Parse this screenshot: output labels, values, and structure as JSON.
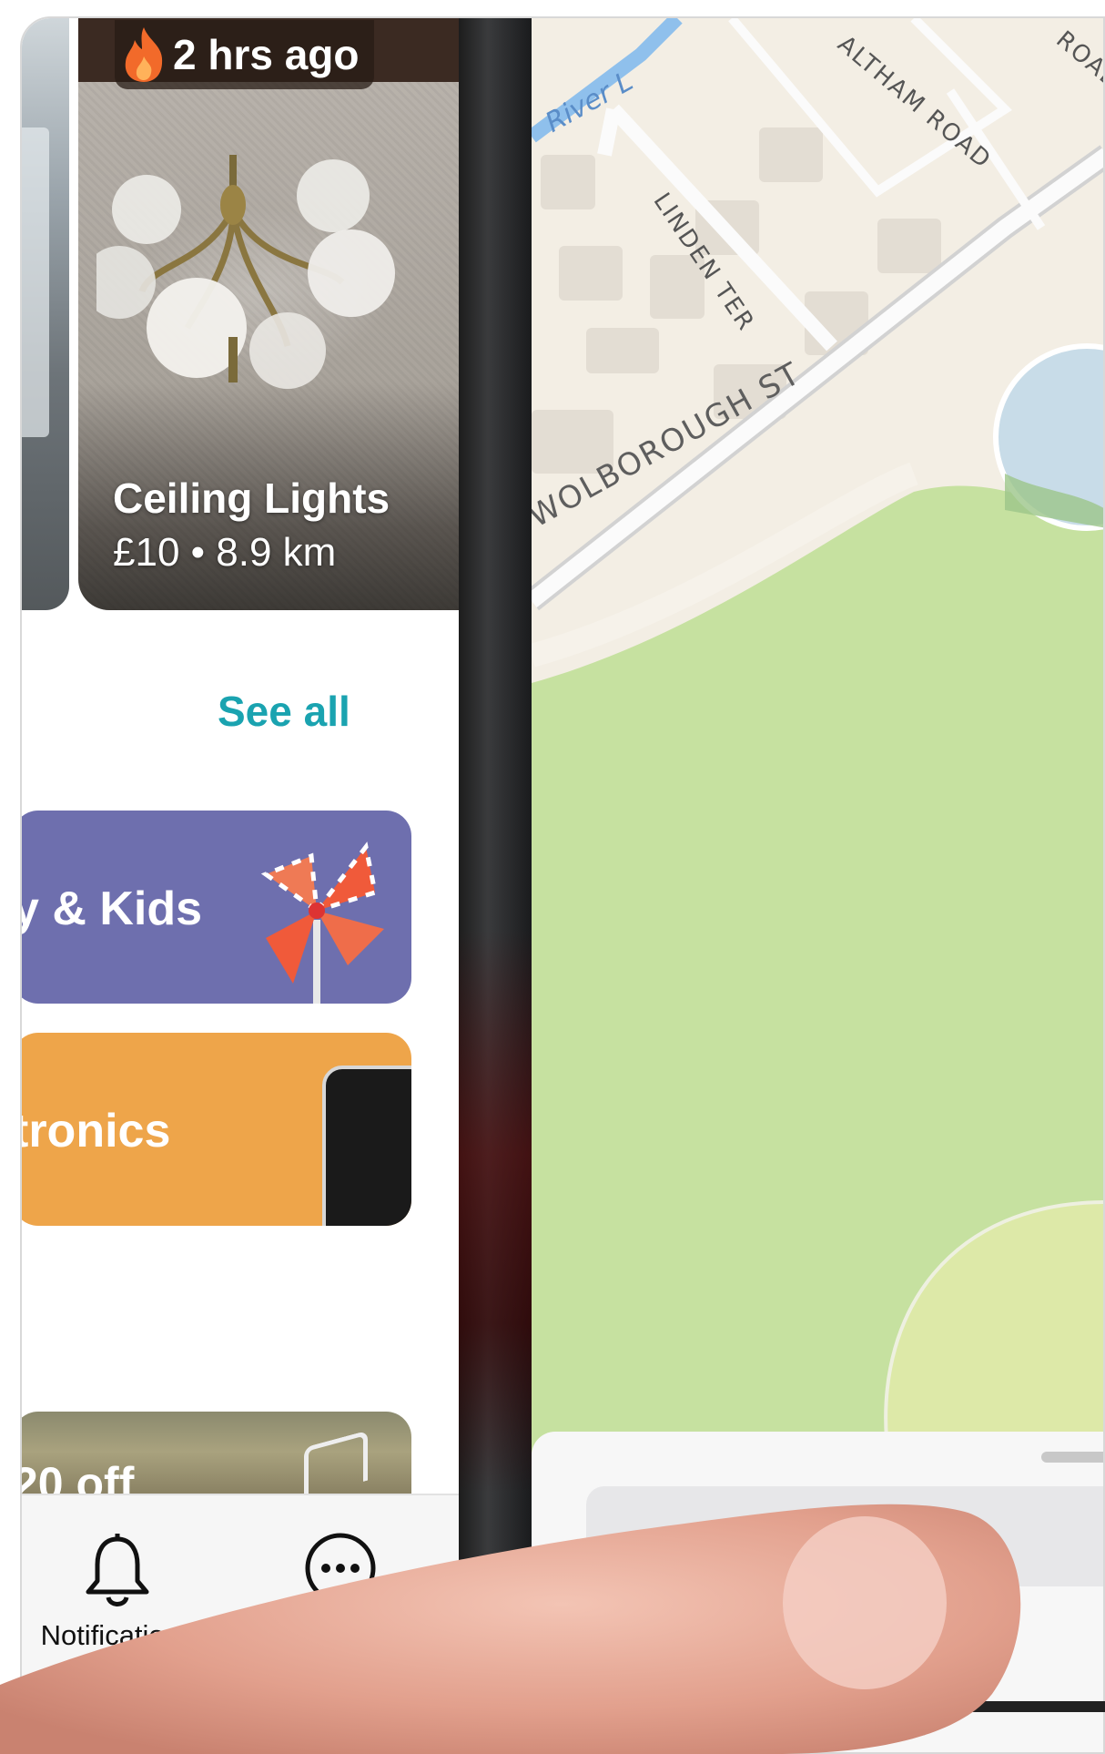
{
  "listing": {
    "posted": "2 hrs ago",
    "title": "Ceiling Lights",
    "meta": "£10 • 8.9 km",
    "icon": "flame-icon"
  },
  "section": {
    "see_all": "See all"
  },
  "categories": [
    {
      "label": "y & Kids",
      "color": "#6e6fae"
    },
    {
      "label": "tronics",
      "color": "#eea54a"
    }
  ],
  "promo": {
    "label": "20 off"
  },
  "tabbar": {
    "notifications": "Notifications",
    "more_icon": "more-icon",
    "bell_icon": "bell-icon"
  },
  "map": {
    "streets": {
      "wolborough": "WOLBOROUGH ST",
      "linden": "LINDEN TER",
      "altham": "ALTHAM ROAD",
      "road": "ROAD"
    },
    "river": "River L",
    "colors": {
      "park": "#c6e1a0",
      "land": "#f3eee4",
      "water": "#6fa7dc"
    }
  },
  "colors": {
    "accent": "#1aa3b0"
  }
}
